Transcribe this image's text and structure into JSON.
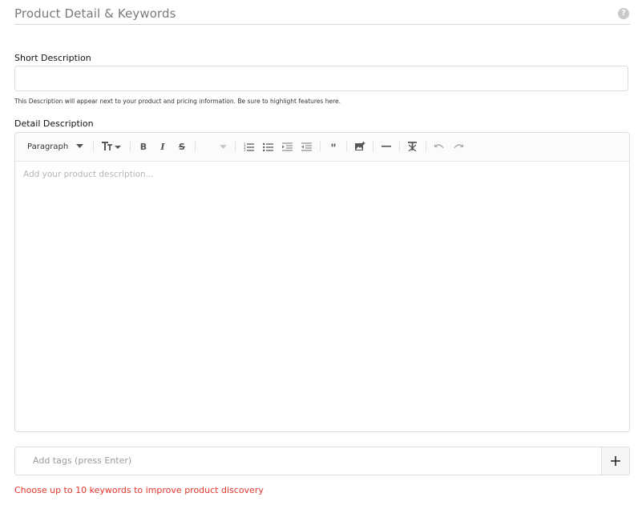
{
  "section": {
    "title": "Product Detail & Keywords",
    "help_icon": "question-circle-icon"
  },
  "short_description": {
    "label": "Short Description",
    "value": "",
    "helper": "This Description will appear next to your product and pricing information. Be sure to highlight features here."
  },
  "detail_description": {
    "label": "Detail Description",
    "toolbar": {
      "paragraph_label": "Paragraph",
      "icons": [
        "caret-down-icon",
        "text-size-icon",
        "bold-icon",
        "italic-icon",
        "strikethrough-icon",
        "numbered-list-icon",
        "bulleted-list-icon",
        "indent-icon",
        "outdent-icon",
        "blockquote-icon",
        "insert-image-icon",
        "horizontal-rule-icon",
        "clear-format-icon",
        "undo-icon",
        "redo-icon"
      ]
    },
    "placeholder": "Add your product description..."
  },
  "tags": {
    "placeholder": "Add tags (press Enter)",
    "add_icon": "plus-icon"
  },
  "keywords_hint": "Choose up to 10 keywords to improve product discovery",
  "colors": {
    "hint_red": "#e0362b",
    "border": "#dcdcdc",
    "title_gray": "#7a7a7a"
  }
}
